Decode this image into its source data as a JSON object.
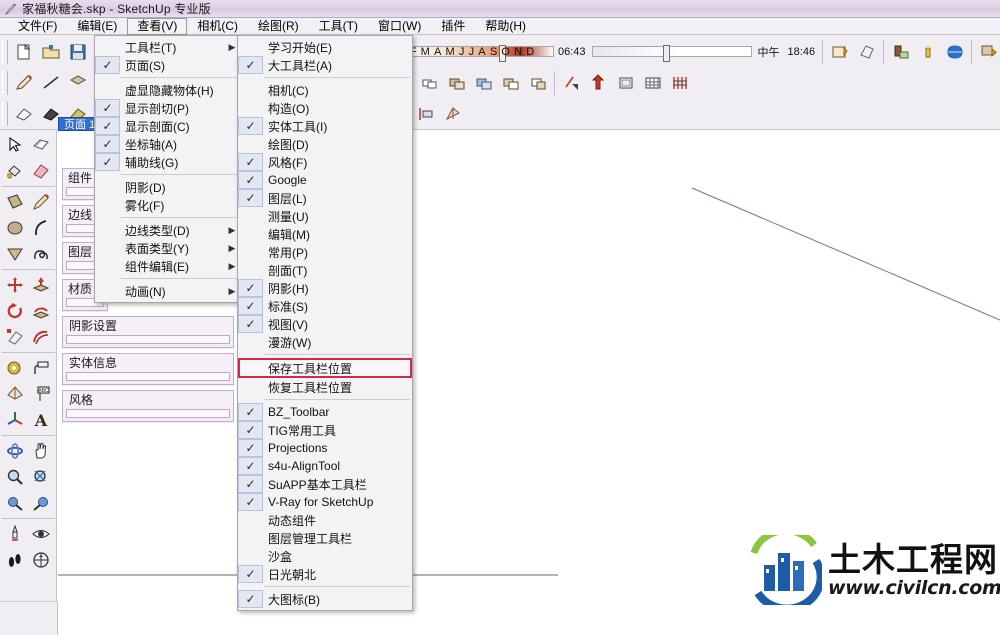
{
  "titlebar": {
    "icon": "sketchup-pencil-icon",
    "title": "家福秋糖会.skp - SketchUp 专业版"
  },
  "menubar": {
    "items": [
      {
        "label": "文件(F)",
        "active": false
      },
      {
        "label": "编辑(E)",
        "active": false
      },
      {
        "label": "查看(V)",
        "active": true
      },
      {
        "label": "相机(C)",
        "active": false
      },
      {
        "label": "绘图(R)",
        "active": false
      },
      {
        "label": "工具(T)",
        "active": false
      },
      {
        "label": "窗口(W)",
        "active": false
      },
      {
        "label": "插件",
        "active": false
      },
      {
        "label": "帮助(H)",
        "active": false
      }
    ]
  },
  "toolbars": {
    "shadow": {
      "month_ticks": "JFMAMJJASOND",
      "time_start": "06:43",
      "noon_label": "中午",
      "time_end": "18:46"
    },
    "row1_icons": [
      "new-file-icon",
      "open-folder-icon",
      "save-disk-icon",
      "cut-icon",
      "copy-icon",
      "paste-icon",
      "erase-icon",
      "undo-icon",
      "redo-icon",
      "print-icon",
      "model-info-icon",
      "section-plane-icon",
      "solid-tool-icon",
      "shadow-toggle-icon",
      "fog-icon",
      "display-settings-icon"
    ],
    "row2_icons": [
      "pencil-icon",
      "eraser-icon",
      "rectangle-icon",
      "circle-icon",
      "arc-icon",
      "polygon-icon",
      "freehand-icon",
      "move-icon",
      "pushpull-icon",
      "rotate-icon",
      "followme-icon",
      "scale-icon",
      "offset-icon",
      "tape-measure-icon",
      "protractor-icon",
      "axes-icon",
      "dimension-icon",
      "text-icon",
      "3dtext-icon",
      "orbit-icon",
      "pan-icon",
      "zoom-icon",
      "zoom-window-icon",
      "zoom-extents-icon",
      "previous-view-icon",
      "position-camera-icon",
      "look-around-icon",
      "walk-icon",
      "section-icon"
    ],
    "row3_icons": [
      "component-icon",
      "group-icon",
      "layer-icon",
      "material-icon",
      "style-icon",
      "scene-icon",
      "xray-icon",
      "wireframe-icon",
      "hidden-line-icon",
      "shaded-icon",
      "texture-icon",
      "monochrome-icon",
      "iso-view-icon",
      "top-view-icon",
      "front-view-icon",
      "right-view-icon",
      "back-view-icon",
      "left-view-icon",
      "bottom-view-icon",
      "perspective-icon"
    ]
  },
  "left_toolbar": {
    "groups": [
      [
        "select-arrow-icon",
        "make-component-icon",
        "paint-bucket-icon",
        "eraser-icon"
      ],
      [
        "rectangle-icon",
        "pencil-line-icon",
        "circle-icon",
        "arc-icon",
        "polygon-icon",
        "freehand-icon"
      ],
      [
        "move-icon",
        "pushpull-icon",
        "rotate-icon",
        "followme-icon",
        "scale-icon",
        "offset-icon"
      ],
      [
        "tape-measure-icon",
        "dimension-icon",
        "protractor-icon",
        "text-label-icon",
        "axes-icon",
        "3d-text-icon"
      ],
      [
        "orbit-icon",
        "pan-icon",
        "zoom-icon",
        "zoom-window-icon",
        "previous-view-icon",
        "next-view-icon"
      ],
      [
        "position-camera-icon",
        "look-around-icon",
        "walk-icon",
        "section-plane-icon"
      ]
    ]
  },
  "page_tab": {
    "label": "页面 1"
  },
  "panels": [
    {
      "title": "组件",
      "width": "narrow"
    },
    {
      "title": "边线",
      "width": "narrow"
    },
    {
      "title": "图层",
      "width": "narrow"
    },
    {
      "title": "材质",
      "width": "narrow"
    },
    {
      "title": "阴影设置",
      "width": "wide"
    },
    {
      "title": "实体信息",
      "width": "wide"
    },
    {
      "title": "风格",
      "width": "wide"
    }
  ],
  "view_menu": {
    "items": [
      {
        "label": "工具栏(T)",
        "checked": false,
        "submenu": true,
        "separator_after": false
      },
      {
        "label": "页面(S)",
        "checked": true,
        "submenu": false,
        "separator_after": true
      },
      {
        "label": "虚显隐藏物体(H)",
        "checked": false,
        "submenu": false,
        "separator_after": false
      },
      {
        "label": "显示剖切(P)",
        "checked": true,
        "submenu": false,
        "separator_after": false
      },
      {
        "label": "显示剖面(C)",
        "checked": true,
        "submenu": false,
        "separator_after": false
      },
      {
        "label": "坐标轴(A)",
        "checked": true,
        "submenu": false,
        "separator_after": false
      },
      {
        "label": "辅助线(G)",
        "checked": true,
        "submenu": false,
        "separator_after": true
      },
      {
        "label": "阴影(D)",
        "checked": false,
        "submenu": false,
        "separator_after": false
      },
      {
        "label": "雾化(F)",
        "checked": false,
        "submenu": false,
        "separator_after": true
      },
      {
        "label": "边线类型(D)",
        "checked": false,
        "submenu": true,
        "separator_after": false
      },
      {
        "label": "表面类型(Y)",
        "checked": false,
        "submenu": true,
        "separator_after": false
      },
      {
        "label": "组件编辑(E)",
        "checked": false,
        "submenu": true,
        "separator_after": true
      },
      {
        "label": "动画(N)",
        "checked": false,
        "submenu": true,
        "separator_after": false
      }
    ]
  },
  "toolbar_submenu": {
    "highlight_color": "#cf2a46",
    "items": [
      {
        "label": "学习开始(E)",
        "checked": false,
        "separator_after": false,
        "highlighted": false
      },
      {
        "label": "大工具栏(A)",
        "checked": true,
        "separator_after": true,
        "highlighted": false
      },
      {
        "label": "相机(C)",
        "checked": false,
        "separator_after": false,
        "highlighted": false
      },
      {
        "label": "构造(O)",
        "checked": false,
        "separator_after": false,
        "highlighted": false
      },
      {
        "label": "实体工具(I)",
        "checked": true,
        "separator_after": false,
        "highlighted": false
      },
      {
        "label": "绘图(D)",
        "checked": false,
        "separator_after": false,
        "highlighted": false
      },
      {
        "label": "风格(F)",
        "checked": true,
        "separator_after": false,
        "highlighted": false
      },
      {
        "label": "Google",
        "checked": true,
        "separator_after": false,
        "highlighted": false
      },
      {
        "label": "图层(L)",
        "checked": true,
        "separator_after": false,
        "highlighted": false
      },
      {
        "label": "测量(U)",
        "checked": false,
        "separator_after": false,
        "highlighted": false
      },
      {
        "label": "编辑(M)",
        "checked": false,
        "separator_after": false,
        "highlighted": false
      },
      {
        "label": "常用(P)",
        "checked": false,
        "separator_after": false,
        "highlighted": false
      },
      {
        "label": "剖面(T)",
        "checked": false,
        "separator_after": false,
        "highlighted": false
      },
      {
        "label": "阴影(H)",
        "checked": true,
        "separator_after": false,
        "highlighted": false
      },
      {
        "label": "标准(S)",
        "checked": true,
        "separator_after": false,
        "highlighted": false
      },
      {
        "label": "视图(V)",
        "checked": true,
        "separator_after": false,
        "highlighted": false
      },
      {
        "label": "漫游(W)",
        "checked": false,
        "separator_after": true,
        "highlighted": false
      },
      {
        "label": "保存工具栏位置",
        "checked": false,
        "separator_after": false,
        "highlighted": true
      },
      {
        "label": "恢复工具栏位置",
        "checked": false,
        "separator_after": true,
        "highlighted": false
      },
      {
        "label": "BZ_Toolbar",
        "checked": true,
        "separator_after": false,
        "highlighted": false
      },
      {
        "label": "TIG常用工具",
        "checked": true,
        "separator_after": false,
        "highlighted": false
      },
      {
        "label": "Projections",
        "checked": true,
        "separator_after": false,
        "highlighted": false
      },
      {
        "label": "s4u-AlignTool",
        "checked": true,
        "separator_after": false,
        "highlighted": false
      },
      {
        "label": "SuAPP基本工具栏",
        "checked": true,
        "separator_after": false,
        "highlighted": false
      },
      {
        "label": "V-Ray for SketchUp",
        "checked": true,
        "separator_after": false,
        "highlighted": false
      },
      {
        "label": "动态组件",
        "checked": false,
        "separator_after": false,
        "highlighted": false
      },
      {
        "label": "图层管理工具栏",
        "checked": false,
        "separator_after": false,
        "highlighted": false
      },
      {
        "label": "沙盒",
        "checked": false,
        "separator_after": false,
        "highlighted": false
      },
      {
        "label": "日光朝北",
        "checked": true,
        "separator_after": true,
        "highlighted": false
      },
      {
        "label": "大图标(B)",
        "checked": true,
        "separator_after": false,
        "highlighted": false
      }
    ]
  },
  "canvas": {
    "red_axis_color": "#8a6a74",
    "green_axis_color": "#4c7a4c",
    "background": "#ffffff"
  },
  "watermark": {
    "chinese": "土木工程网",
    "url": "www.civilcn.com",
    "logo": "civilcn-building-logo",
    "blue": "#1f5ca8",
    "green": "#8cc63f"
  }
}
